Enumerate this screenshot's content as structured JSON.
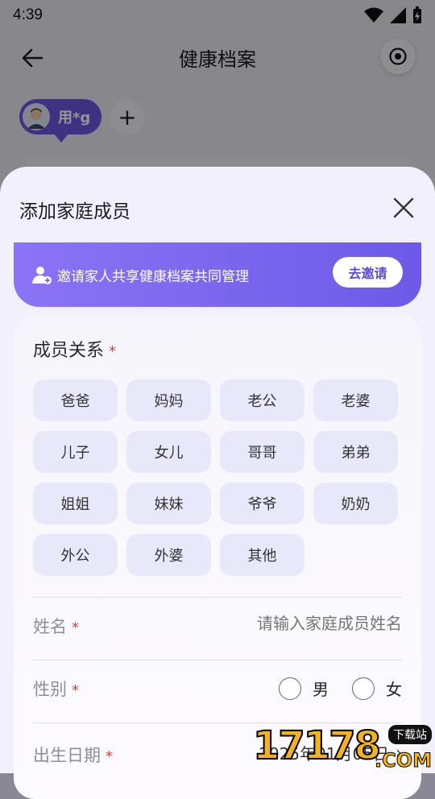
{
  "status_bar": {
    "time": "4:39"
  },
  "header": {
    "title": "健康档案"
  },
  "profile": {
    "user_name": "用*g",
    "add_symbol": "+"
  },
  "sheet": {
    "title": "添加家庭成员",
    "invite": {
      "text": "邀请家人共享健康档案共同管理",
      "button": "去邀请"
    },
    "relation": {
      "label": "成员关系",
      "required_mark": "*",
      "options": [
        "爸爸",
        "妈妈",
        "老公",
        "老婆",
        "儿子",
        "女儿",
        "哥哥",
        "弟弟",
        "姐姐",
        "妹妹",
        "爷爷",
        "奶奶",
        "外公",
        "外婆",
        "其他"
      ]
    },
    "name_field": {
      "label": "姓名",
      "required_mark": "*",
      "placeholder": "请输入家庭成员姓名"
    },
    "gender_field": {
      "label": "性别",
      "required_mark": "*",
      "options": [
        "男",
        "女"
      ]
    },
    "dob_field": {
      "label": "出生日期",
      "required_mark": "*",
      "value": "2025年01月05日",
      "chevron": "›"
    }
  },
  "watermark": {
    "number": "17178",
    "badge": "下载站",
    "suffix": ".COM"
  },
  "colors": {
    "accent": "#6f55e6",
    "chip_bg": "#e8e8fb",
    "required": "#e03a3a"
  }
}
